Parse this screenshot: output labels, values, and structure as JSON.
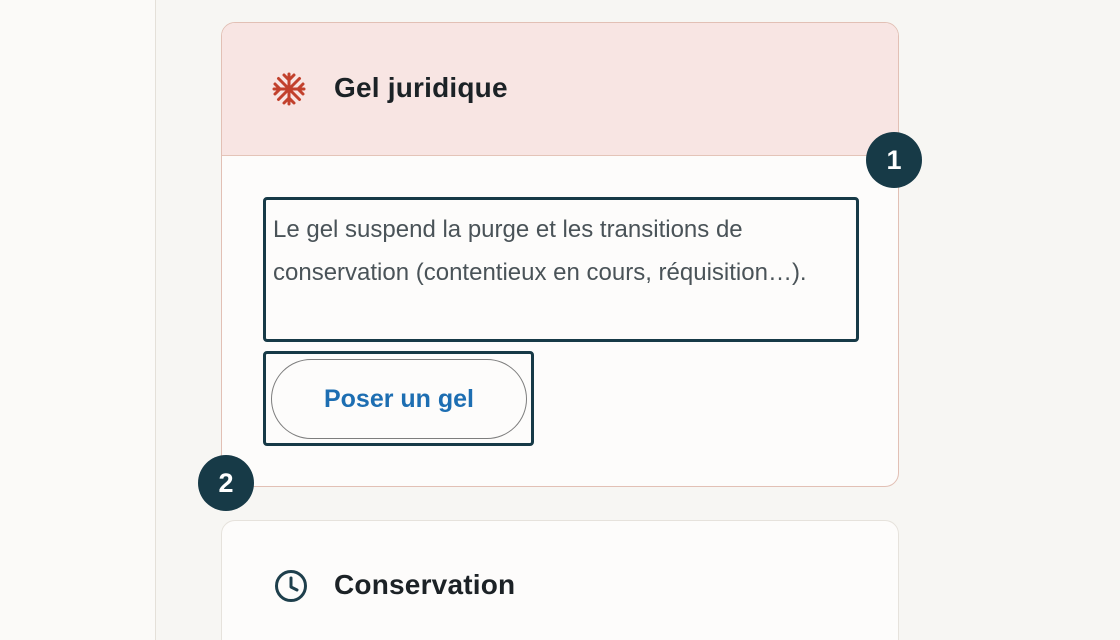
{
  "freeze_card": {
    "title": "Gel juridique",
    "icon": "snowflake-icon",
    "description": "Le gel suspend la purge et les transitions de conservation (contentieux en cours, réquisition…).",
    "button_label": "Poser un gel"
  },
  "markers": {
    "one": "1",
    "two": "2"
  },
  "conservation_card": {
    "title": "Conservation",
    "icon": "clock-icon"
  },
  "colors": {
    "freeze_accent": "#c2412d",
    "freeze_header_bg": "#f8e5e3",
    "marker_bg": "#173a47",
    "button_text": "#1d6eb2"
  }
}
